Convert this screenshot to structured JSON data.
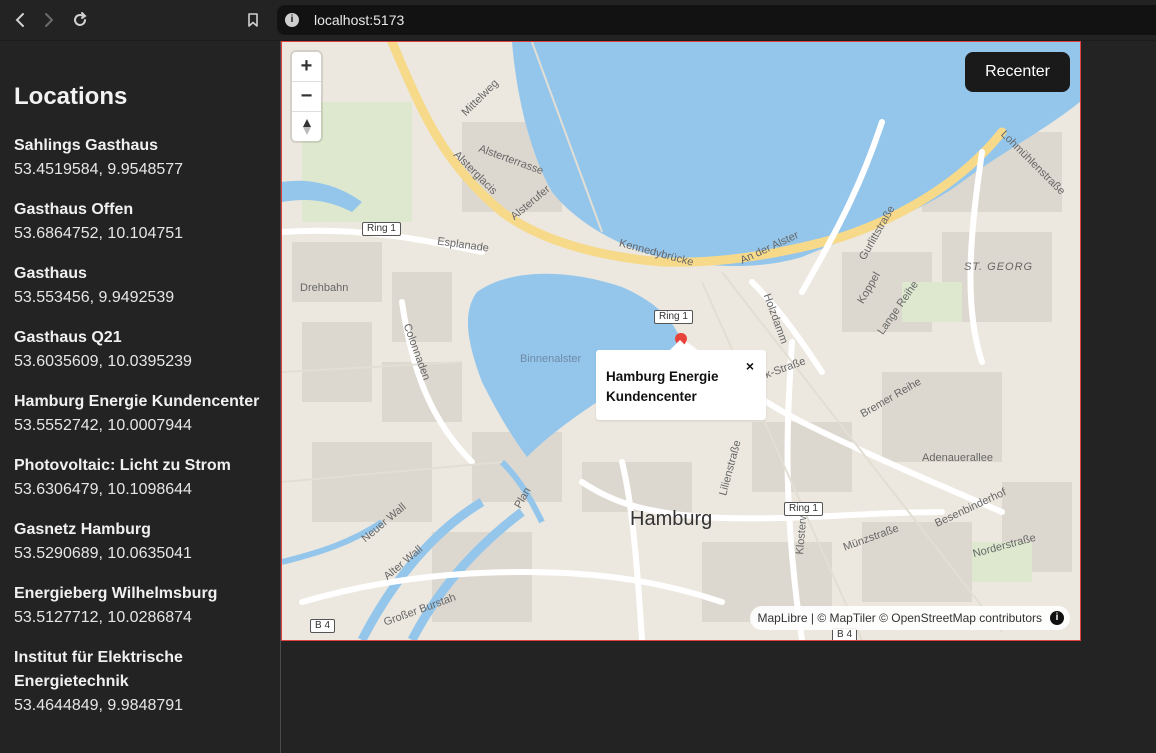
{
  "browser": {
    "url": "localhost:5173",
    "info_icon": "i"
  },
  "sidebar": {
    "title": "Locations",
    "locations": [
      {
        "name": "Sahlings Gasthaus",
        "coords": "53.4519584, 9.9548577"
      },
      {
        "name": "Gasthaus Offen",
        "coords": "53.6864752, 10.104751"
      },
      {
        "name": "Gasthaus",
        "coords": "53.553456, 9.9492539"
      },
      {
        "name": "Gasthaus Q21",
        "coords": "53.6035609, 10.0395239"
      },
      {
        "name": "Hamburg Energie Kundencenter",
        "coords": "53.5552742, 10.0007944"
      },
      {
        "name": "Photovoltaic: Licht zu Strom",
        "coords": "53.6306479, 10.1098644"
      },
      {
        "name": "Gasnetz Hamburg",
        "coords": "53.5290689, 10.0635041"
      },
      {
        "name": "Energieberg Wilhelmsburg",
        "coords": "53.5127712, 10.0286874"
      },
      {
        "name": "Institut für Elektrische Energietechnik",
        "coords": "53.4644849, 9.9848791"
      }
    ]
  },
  "map": {
    "zoom_in": "+",
    "zoom_out": "−",
    "recenter_label": "Recenter",
    "popup_title": "Hamburg Energie Kundencenter",
    "popup_close": "×",
    "attribution": "MapLibre | © MapTiler © OpenStreetMap contributors",
    "attribution_info": "i",
    "labels": {
      "city": "Hamburg",
      "binnenalster": "Binnenalster",
      "st_georg": "ST. GEORG",
      "kennedybruecke": "Kennedybrücke",
      "an_der_alster": "An der Alster",
      "esplanade": "Esplanade",
      "drehbahn": "Drehbahn",
      "colonnaden": "Colonnaden",
      "alsterterrasse": "Alsterterrasse",
      "alsterufer": "Alsterufer",
      "alsterglacis": "Alsterglacis",
      "mittelweg": "Mittelweg",
      "holzdamm": "Holzdamm",
      "koppel": "Koppel",
      "lange_reihe": "Lange Reihe",
      "bremer_reihe": "Bremer Reihe",
      "adenauerallee": "Adenauerallee",
      "besenbinderhof": "Besenbinderhof",
      "nordersstrasse": "Norderstraße",
      "muenzstrasse": "Münzstraße",
      "klosterwall": "Klosterwall",
      "lilienstrasse": "Lilienstraße",
      "neuer_wall": "Neuer Wall",
      "alter_wall": "Alter Wall",
      "grosser_burstah": "Großer Burstah",
      "plan": "Plan",
      "merck_strasse": "-Merck-Straße",
      "gurlittstrasse": "Gurlittstraße",
      "lohmuehlenstrasse": "Lohmühlenstraße",
      "ring1": "Ring 1",
      "b4": "B 4"
    }
  }
}
